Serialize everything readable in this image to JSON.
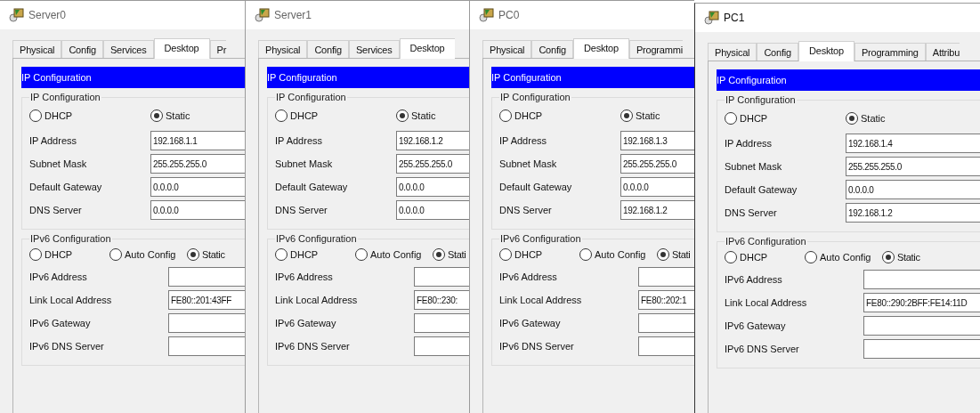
{
  "windows": [
    {
      "title": "Server0",
      "tabs": [
        {
          "label": "Physical",
          "selected": false
        },
        {
          "label": "Config",
          "selected": false
        },
        {
          "label": "Services",
          "selected": false
        },
        {
          "label": "Desktop",
          "selected": true
        },
        {
          "label": "Pr",
          "selected": false
        }
      ],
      "header": "IP Configuration",
      "ipv4": {
        "legend": "IP Configuration",
        "modes": [
          {
            "label": "DHCP",
            "selected": false
          },
          {
            "label": "Static",
            "selected": true
          }
        ],
        "fields": [
          {
            "label": "IP Address",
            "value": "192.168.1.1"
          },
          {
            "label": "Subnet Mask",
            "value": "255.255.255.0"
          },
          {
            "label": "Default Gateway",
            "value": "0.0.0.0"
          },
          {
            "label": "DNS Server",
            "value": "0.0.0.0"
          }
        ]
      },
      "ipv6": {
        "legend": "IPv6 Configuration",
        "modes": [
          {
            "label": "DHCP",
            "selected": false
          },
          {
            "label": "Auto Config",
            "selected": false
          },
          {
            "label": "Static",
            "selected": true
          }
        ],
        "fields": [
          {
            "label": "IPv6 Address"
          },
          {
            "label": "Link Local Address",
            "value": "FE80::201:43FF"
          },
          {
            "label": "IPv6 Gateway"
          },
          {
            "label": "IPv6 DNS Server"
          }
        ]
      }
    },
    {
      "title": "Server1",
      "tabs": [
        {
          "label": "Physical",
          "selected": false
        },
        {
          "label": "Config",
          "selected": false
        },
        {
          "label": "Services",
          "selected": false
        },
        {
          "label": "Desktop",
          "selected": true
        }
      ],
      "header": "IP Configuration",
      "ipv4": {
        "legend": "IP Configuration",
        "modes": [
          {
            "label": "DHCP",
            "selected": false
          },
          {
            "label": "Static",
            "selected": true
          }
        ],
        "fields": [
          {
            "label": "IP Address",
            "value": "192.168.1.2"
          },
          {
            "label": "Subnet Mask",
            "value": "255.255.255.0"
          },
          {
            "label": "Default Gateway",
            "value": "0.0.0.0"
          },
          {
            "label": "DNS Server",
            "value": "0.0.0.0"
          }
        ]
      },
      "ipv6": {
        "legend": "IPv6 Configuration",
        "modes": [
          {
            "label": "DHCP",
            "selected": false
          },
          {
            "label": "Auto Config",
            "selected": false
          },
          {
            "label": "Stati",
            "selected": true
          }
        ],
        "fields": [
          {
            "label": "IPv6 Address"
          },
          {
            "label": "Link Local Address",
            "value": "FE80::230:"
          },
          {
            "label": "IPv6 Gateway"
          },
          {
            "label": "IPv6 DNS Server"
          }
        ]
      }
    },
    {
      "title": "PC0",
      "tabs": [
        {
          "label": "Physical",
          "selected": false
        },
        {
          "label": "Config",
          "selected": false
        },
        {
          "label": "Desktop",
          "selected": true
        },
        {
          "label": "Programmi",
          "selected": false
        }
      ],
      "header": "IP Configuration",
      "ipv4": {
        "legend": "IP Configuration",
        "modes": [
          {
            "label": "DHCP",
            "selected": false
          },
          {
            "label": "Static",
            "selected": true
          }
        ],
        "fields": [
          {
            "label": "IP Address",
            "value": "192.168.1.3"
          },
          {
            "label": "Subnet Mask",
            "value": "255.255.255.0"
          },
          {
            "label": "Default Gateway",
            "value": "0.0.0.0"
          },
          {
            "label": "DNS Server",
            "value": "192.168.1.2"
          }
        ]
      },
      "ipv6": {
        "legend": "IPv6 Configuration",
        "modes": [
          {
            "label": "DHCP",
            "selected": false
          },
          {
            "label": "Auto Config",
            "selected": false
          },
          {
            "label": "Stati",
            "selected": true
          }
        ],
        "fields": [
          {
            "label": "IPv6 Address"
          },
          {
            "label": "Link Local Address",
            "value": "FE80::202:1"
          },
          {
            "label": "IPv6 Gateway"
          },
          {
            "label": "IPv6 DNS Server"
          }
        ]
      }
    },
    {
      "title": "PC1",
      "tabs": [
        {
          "label": "Physical",
          "selected": false
        },
        {
          "label": "Config",
          "selected": false
        },
        {
          "label": "Desktop",
          "selected": true
        },
        {
          "label": "Programming",
          "selected": false
        },
        {
          "label": "Attribu",
          "selected": false
        }
      ],
      "header": "IP Configuration",
      "ipv4": {
        "legend": "IP Configuration",
        "modes": [
          {
            "label": "DHCP",
            "selected": false
          },
          {
            "label": "Static",
            "selected": true
          }
        ],
        "fields": [
          {
            "label": "IP Address",
            "value": "192.168.1.4"
          },
          {
            "label": "Subnet Mask",
            "value": "255.255.255.0"
          },
          {
            "label": "Default Gateway",
            "value": "0.0.0.0"
          },
          {
            "label": "DNS Server",
            "value": "192.168.1.2"
          }
        ]
      },
      "ipv6": {
        "legend": "IPv6 Configuration",
        "modes": [
          {
            "label": "DHCP",
            "selected": false
          },
          {
            "label": "Auto Config",
            "selected": false
          },
          {
            "label": "Static",
            "selected": true
          }
        ],
        "fields": [
          {
            "label": "IPv6 Address"
          },
          {
            "label": "Link Local Address",
            "value": "FE80::290:2BFF:FE14:11D"
          },
          {
            "label": "IPv6 Gateway"
          },
          {
            "label": "IPv6 DNS Server"
          }
        ]
      }
    }
  ]
}
